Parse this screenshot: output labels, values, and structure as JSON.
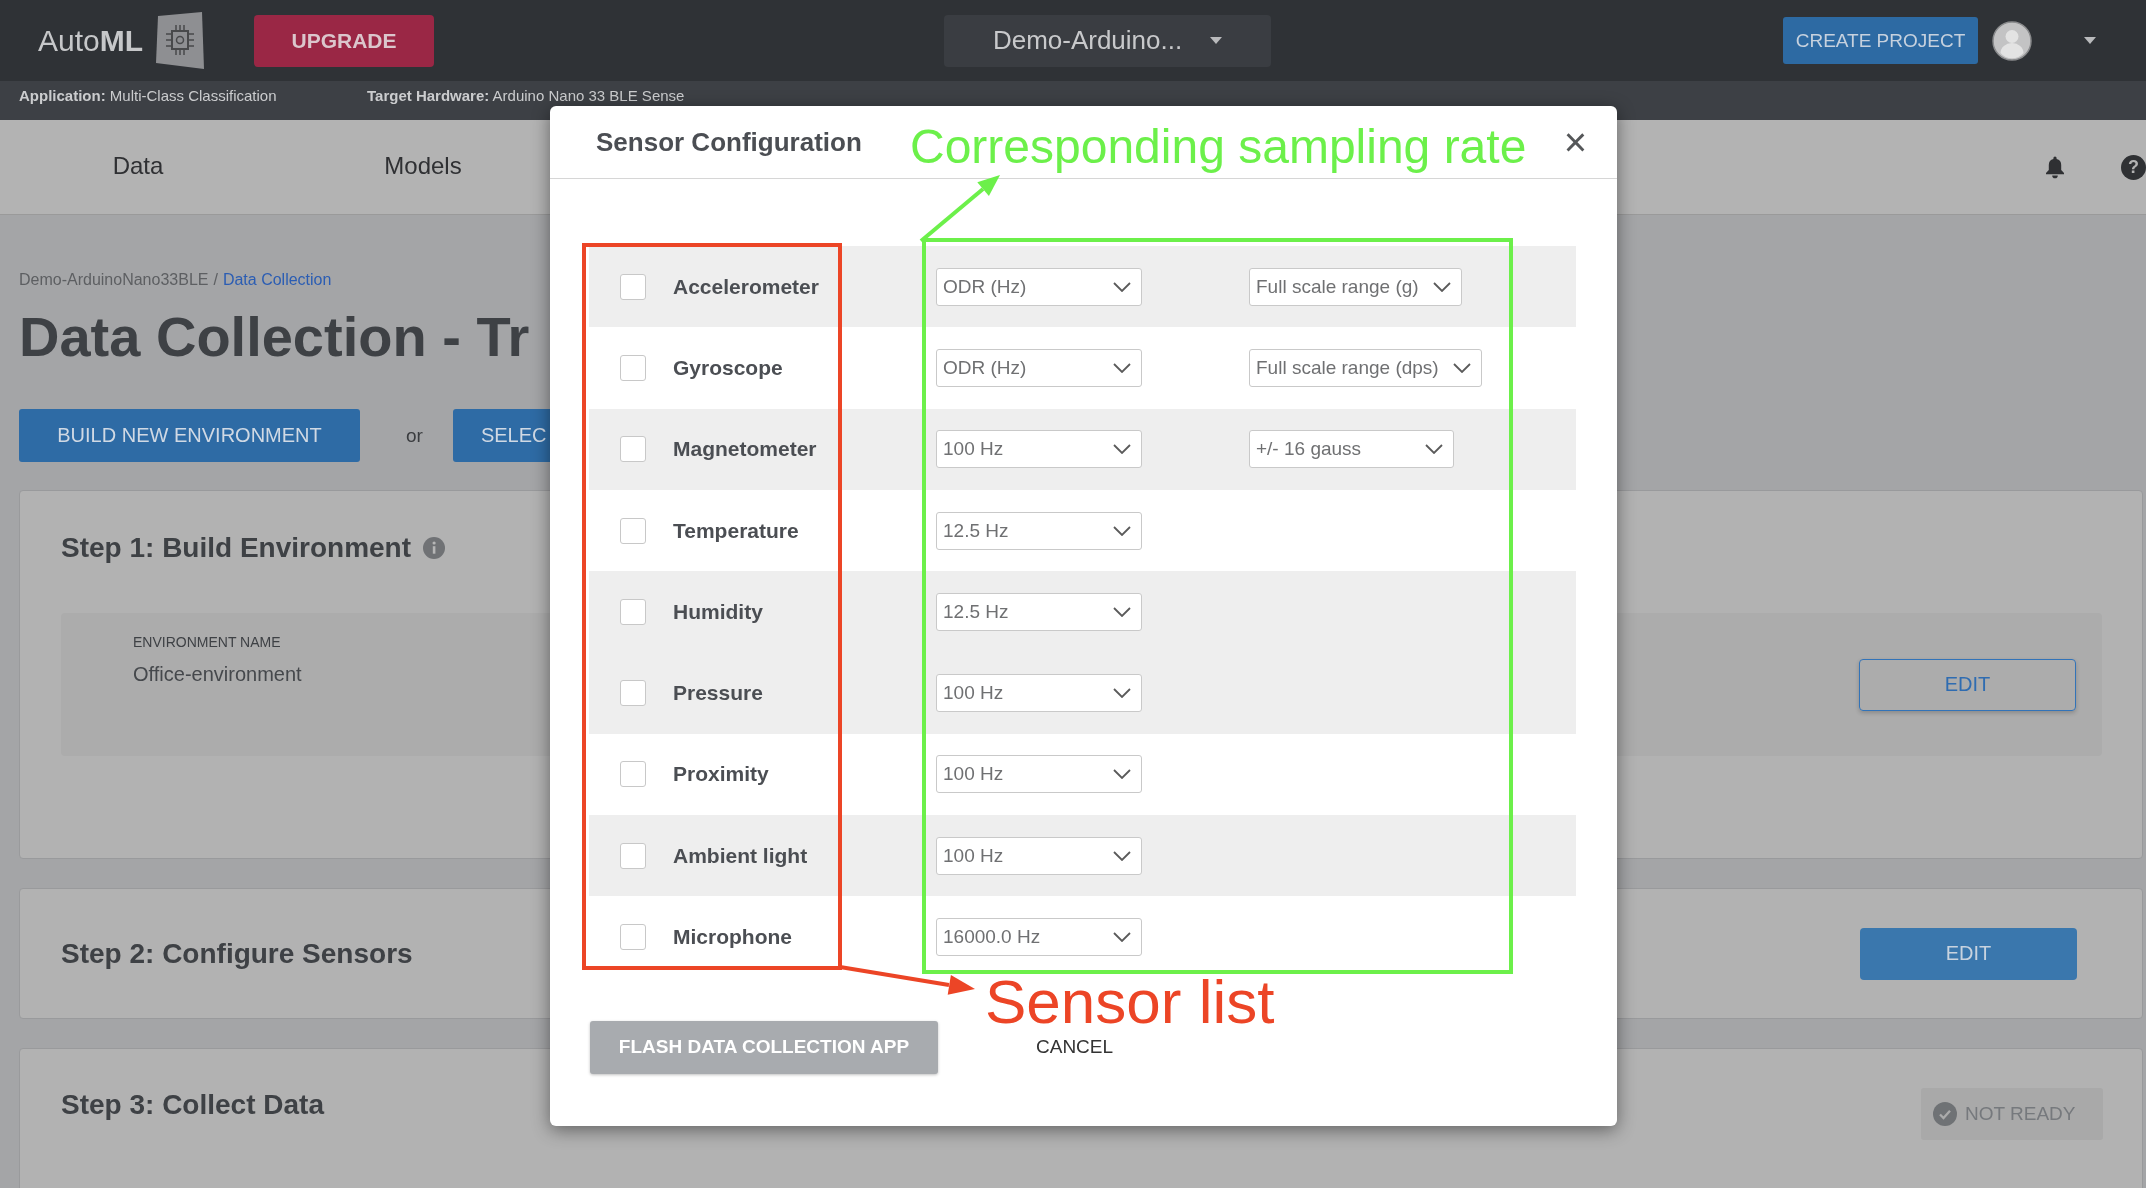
{
  "top_bar": {
    "logo": "Auto**ML**",
    "upgrade_button": "UPGRADE",
    "project_selector": "Demo-Arduino...",
    "create_project_button": "CREATE PROJECT"
  },
  "info_bar": [
    "**Application:** Multi-Class Classification",
    "**Target Hardware:** Arduino Nano 33 BLE Sense"
  ],
  "nav": {
    "tabs": [
      {
        "label": "Data",
        "selected": false
      },
      {
        "label": "Models",
        "selected": false
      }
    ],
    "help": "?"
  },
  "breadcrumb": {
    "items": [
      "Demo-ArduinoNano33BLE",
      "Data Collection"
    ],
    "separator": "/"
  },
  "page_title": "Data Collection - Tr",
  "actions": {
    "build_button": "BUILD NEW ENVIRONMENT",
    "or": "or",
    "select_button": "SELEC"
  },
  "steps": [
    {
      "kind": "environment",
      "title": "Step 1: Build Environment",
      "field_label": "ENVIRONMENT NAME",
      "field_value": "Office-environment",
      "button": "EDIT"
    },
    {
      "kind": "action",
      "title": "Step 2: Configure Sensors",
      "button": "EDIT"
    },
    {
      "kind": "status",
      "title": "Step 3: Collect Data",
      "status": "NOT READY"
    }
  ],
  "modal": {
    "title": "Sensor Configuration",
    "close": "×",
    "sensors": [
      {
        "name": "Accelerometer",
        "checked": false,
        "shaded": true,
        "settings": [
          "ODR (Hz)",
          "Full scale range (g)"
        ]
      },
      {
        "name": "Gyroscope",
        "checked": false,
        "shaded": false,
        "settings": [
          "ODR (Hz)",
          "Full scale range (dps)"
        ]
      },
      {
        "name": "Magnetometer",
        "checked": false,
        "shaded": true,
        "settings": [
          "100 Hz",
          "+/- 16 gauss"
        ]
      },
      {
        "name": "Temperature",
        "checked": false,
        "shaded": false,
        "settings": [
          "12.5 Hz"
        ]
      },
      {
        "name": "Humidity",
        "checked": false,
        "shaded": true,
        "settings": [
          "12.5 Hz"
        ]
      },
      {
        "name": "Pressure",
        "checked": false,
        "shaded": true,
        "settings": [
          "100 Hz"
        ]
      },
      {
        "name": "Proximity",
        "checked": false,
        "shaded": false,
        "settings": [
          "100 Hz"
        ]
      },
      {
        "name": "Ambient light",
        "checked": false,
        "shaded": true,
        "settings": [
          "100 Hz"
        ]
      },
      {
        "name": "Microphone",
        "checked": false,
        "shaded": false,
        "settings": [
          "16000.0 Hz"
        ]
      }
    ],
    "flash_button": {
      "label": "FLASH DATA COLLECTION APP",
      "disabled": true
    },
    "cancel_button": "CANCEL"
  },
  "annotations": [
    {
      "text": "Corresponding sampling rate",
      "color": "#6cf04a"
    },
    {
      "text": "Sensor list",
      "color": "#ec4526"
    }
  ]
}
